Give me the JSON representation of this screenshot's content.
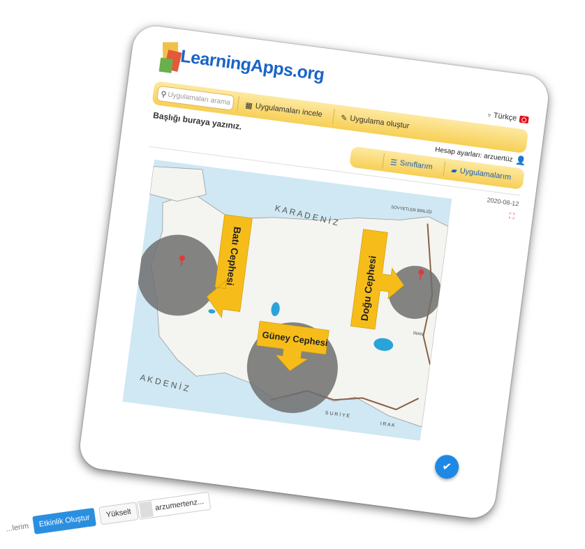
{
  "header": {
    "logo_text": "LearningApps.org",
    "search_placeholder": "Uygulamaları arama",
    "nav": {
      "browse_label": "Uygulamaları incele",
      "create_label": "Uygulama oluştur"
    },
    "language": "Türkçe"
  },
  "page": {
    "title": "Başlığı buraya yazınız.",
    "user_label": "Hesap ayarları: arzuertüz",
    "classes_label": "Sınıflarım",
    "apps_label": "Uygulamalarım",
    "date": "2020-08-12"
  },
  "map": {
    "labels": {
      "karadeniz": "K A R A D E N İ Z",
      "akdeniz": "A K D E N İ Z",
      "suriye": "S U R İ Y E",
      "irak": "I R A K",
      "sovyetler": "SOVYETLER BİRLİĞİ",
      "iran": "İRAN"
    },
    "arrows": {
      "west": "Batı Cephesi",
      "south": "Güney Cephesi",
      "east": "Doğu Cephesi"
    },
    "colors": {
      "sea": "#cfe8f3",
      "land": "#f4f4f0",
      "circle": "#6e6e6e",
      "arrow": "#f6bd1a",
      "border": "#8a6048"
    }
  },
  "bottom_toolbar": {
    "menu_label": "...lerim",
    "create_label": "Etkinlik Oluştur",
    "upgrade_label": "Yükselt",
    "profile_label": "arzumertenz..."
  }
}
